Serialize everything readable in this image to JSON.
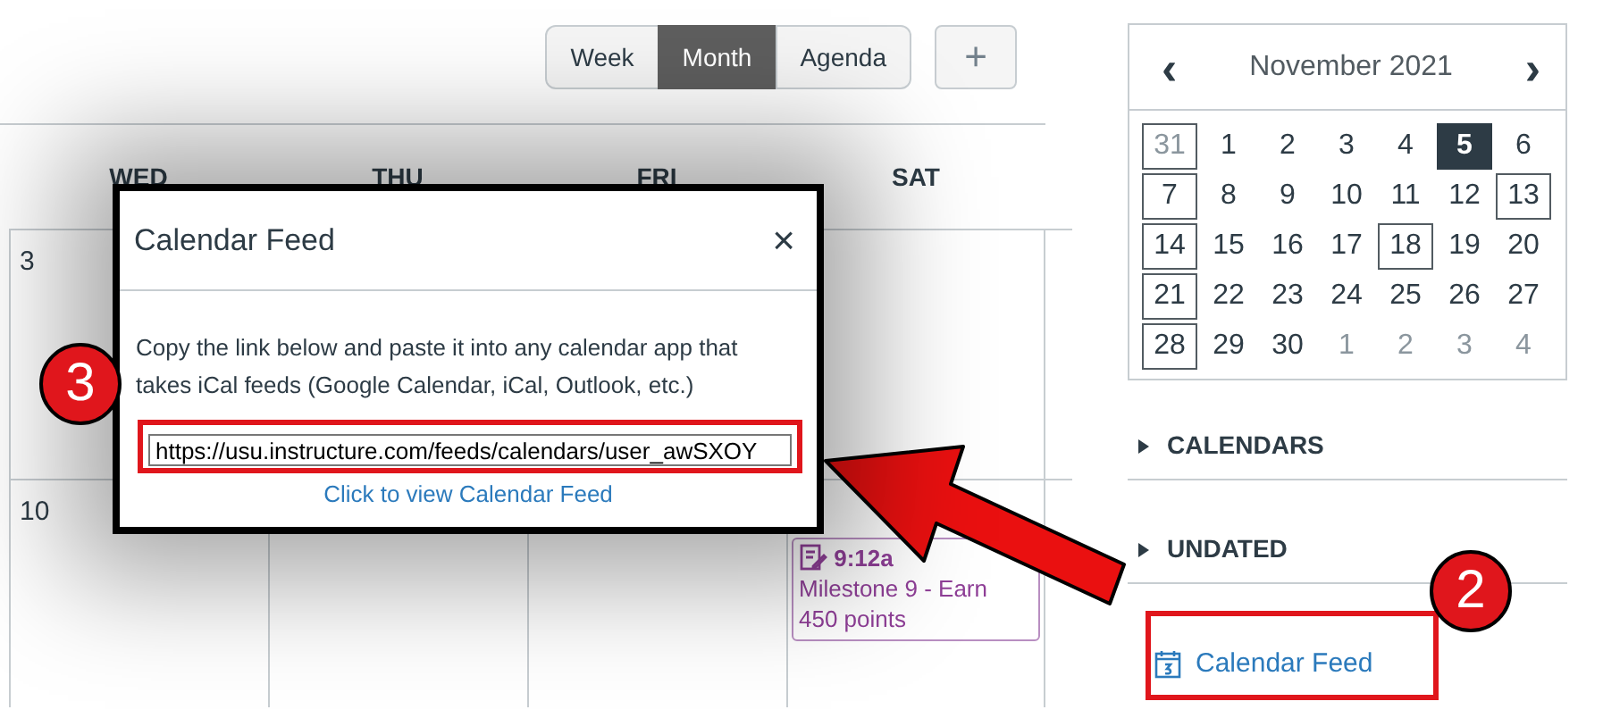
{
  "toolbar": {
    "views": [
      {
        "label": "Week",
        "selected": false
      },
      {
        "label": "Month",
        "selected": true
      },
      {
        "label": "Agenda",
        "selected": false
      }
    ],
    "add_button": "+"
  },
  "day_headers": [
    "WED",
    "THU",
    "FRI",
    "SAT"
  ],
  "weeks": [
    {
      "cells": [
        {
          "date": "3"
        },
        {},
        {},
        {}
      ]
    },
    {
      "cells": [
        {
          "date": "10"
        },
        {},
        {},
        {
          "event": {
            "time": "9:12a",
            "title": "Milestone 9 - Earn 450 points"
          }
        }
      ]
    }
  ],
  "mini_calendar": {
    "title": "November 2021",
    "prev": "‹",
    "next": "›",
    "days": [
      {
        "d": "31",
        "muted": true,
        "boxed": true,
        "selected": false
      },
      {
        "d": "1",
        "muted": false,
        "boxed": false,
        "selected": false
      },
      {
        "d": "2",
        "muted": false,
        "boxed": false,
        "selected": false
      },
      {
        "d": "3",
        "muted": false,
        "boxed": false,
        "selected": false
      },
      {
        "d": "4",
        "muted": false,
        "boxed": false,
        "selected": false
      },
      {
        "d": "5",
        "muted": false,
        "boxed": false,
        "selected": true
      },
      {
        "d": "6",
        "muted": false,
        "boxed": false,
        "selected": false
      },
      {
        "d": "7",
        "muted": false,
        "boxed": true,
        "selected": false
      },
      {
        "d": "8",
        "muted": false,
        "boxed": false,
        "selected": false
      },
      {
        "d": "9",
        "muted": false,
        "boxed": false,
        "selected": false
      },
      {
        "d": "10",
        "muted": false,
        "boxed": false,
        "selected": false
      },
      {
        "d": "11",
        "muted": false,
        "boxed": false,
        "selected": false
      },
      {
        "d": "12",
        "muted": false,
        "boxed": false,
        "selected": false
      },
      {
        "d": "13",
        "muted": false,
        "boxed": true,
        "selected": false
      },
      {
        "d": "14",
        "muted": false,
        "boxed": true,
        "selected": false
      },
      {
        "d": "15",
        "muted": false,
        "boxed": false,
        "selected": false
      },
      {
        "d": "16",
        "muted": false,
        "boxed": false,
        "selected": false
      },
      {
        "d": "17",
        "muted": false,
        "boxed": false,
        "selected": false
      },
      {
        "d": "18",
        "muted": false,
        "boxed": true,
        "selected": false
      },
      {
        "d": "19",
        "muted": false,
        "boxed": false,
        "selected": false
      },
      {
        "d": "20",
        "muted": false,
        "boxed": false,
        "selected": false
      },
      {
        "d": "21",
        "muted": false,
        "boxed": true,
        "selected": false
      },
      {
        "d": "22",
        "muted": false,
        "boxed": false,
        "selected": false
      },
      {
        "d": "23",
        "muted": false,
        "boxed": false,
        "selected": false
      },
      {
        "d": "24",
        "muted": false,
        "boxed": false,
        "selected": false
      },
      {
        "d": "25",
        "muted": false,
        "boxed": false,
        "selected": false
      },
      {
        "d": "26",
        "muted": false,
        "boxed": false,
        "selected": false
      },
      {
        "d": "27",
        "muted": false,
        "boxed": false,
        "selected": false
      },
      {
        "d": "28",
        "muted": false,
        "boxed": true,
        "selected": false
      },
      {
        "d": "29",
        "muted": false,
        "boxed": false,
        "selected": false
      },
      {
        "d": "30",
        "muted": false,
        "boxed": false,
        "selected": false
      },
      {
        "d": "1",
        "muted": true,
        "boxed": false,
        "selected": false
      },
      {
        "d": "2",
        "muted": true,
        "boxed": false,
        "selected": false
      },
      {
        "d": "3",
        "muted": true,
        "boxed": false,
        "selected": false
      },
      {
        "d": "4",
        "muted": true,
        "boxed": false,
        "selected": false
      }
    ]
  },
  "sections": [
    {
      "label": "CALENDARS",
      "expanded": false
    },
    {
      "label": "UNDATED",
      "expanded": false
    }
  ],
  "feed_link": "Calendar Feed",
  "dialog": {
    "title": "Calendar Feed",
    "close": "×",
    "description": "Copy the link below and paste it into any calendar app that takes iCal feeds (Google Calendar, iCal, Outlook, etc.)",
    "url": "https://usu.instructure.com/feeds/calendars/user_awSXOY",
    "link": "Click to view Calendar Feed"
  },
  "callouts": [
    "3",
    "2"
  ]
}
